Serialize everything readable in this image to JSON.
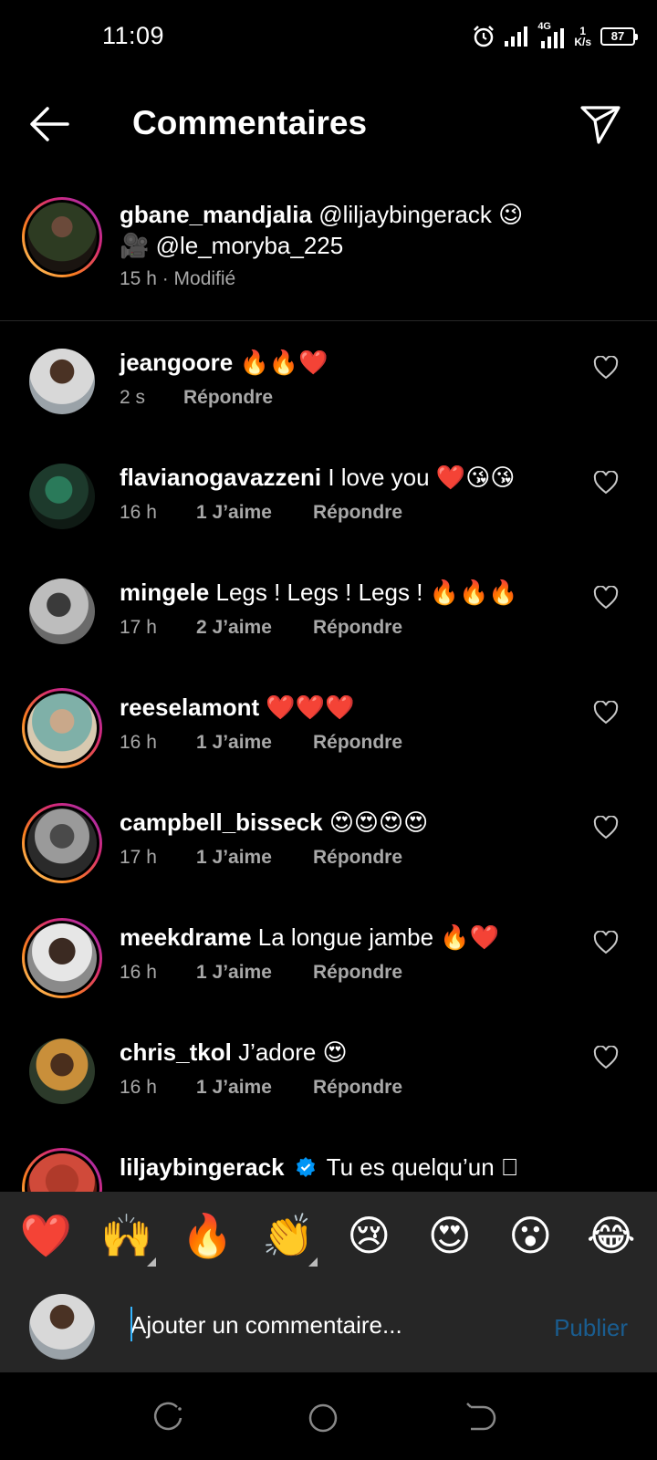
{
  "status_bar": {
    "time": "11:09",
    "network": "4G",
    "net_speed_value": "1",
    "net_speed_unit": "K/s",
    "battery": "87"
  },
  "header": {
    "title": "Commentaires"
  },
  "caption": {
    "username": "gbane_mandjalia",
    "text_line1": "@liljaybingerack 😉",
    "text_line2": "🎥 @le_moryba_225",
    "meta": "15 h · Modifié"
  },
  "comments": [
    {
      "username": "jeangoore",
      "text": "🔥🔥❤️",
      "time": "2 s",
      "likes": "",
      "reply": "Répondre"
    },
    {
      "username": "flavianogavazzeni",
      "text": "I love you ❤️😘😘",
      "time": "16 h",
      "likes": "1 J’aime",
      "reply": "Répondre"
    },
    {
      "username": "mingele",
      "text": "Legs ! Legs ! Legs ! 🔥🔥🔥",
      "time": "17 h",
      "likes": "2 J’aime",
      "reply": "Répondre"
    },
    {
      "username": "reeselamont",
      "text": "❤️❤️❤️",
      "time": "16 h",
      "likes": "1 J’aime",
      "reply": "Répondre"
    },
    {
      "username": "campbell_bisseck",
      "text": "😍😍😍😍",
      "time": "17 h",
      "likes": "1 J’aime",
      "reply": "Répondre"
    },
    {
      "username": "meekdrame",
      "text": "La longue jambe 🔥❤️",
      "time": "16 h",
      "likes": "1 J’aime",
      "reply": "Répondre"
    },
    {
      "username": "chris_tkol",
      "text": "J’adore 😍",
      "time": "16 h",
      "likes": "1 J’aime",
      "reply": "Répondre"
    },
    {
      "username": "liljaybingerack",
      "text": "Tu es quelqu’un 🏾",
      "time": "",
      "likes": "",
      "reply": ""
    }
  ],
  "quick_reactions": [
    "❤️",
    "🙌",
    "🔥",
    "👏",
    "😢",
    "😍",
    "😮",
    "😂"
  ],
  "comment_input": {
    "placeholder": "Ajouter un commentaire...",
    "publish_label": "Publier"
  },
  "colors": {
    "background": "#000000",
    "secondary_text": "#a8a8a8",
    "panel": "#262626",
    "publish_disabled": "#1a5d90",
    "story_ring": "#d62976",
    "verified": "#0095f6"
  }
}
